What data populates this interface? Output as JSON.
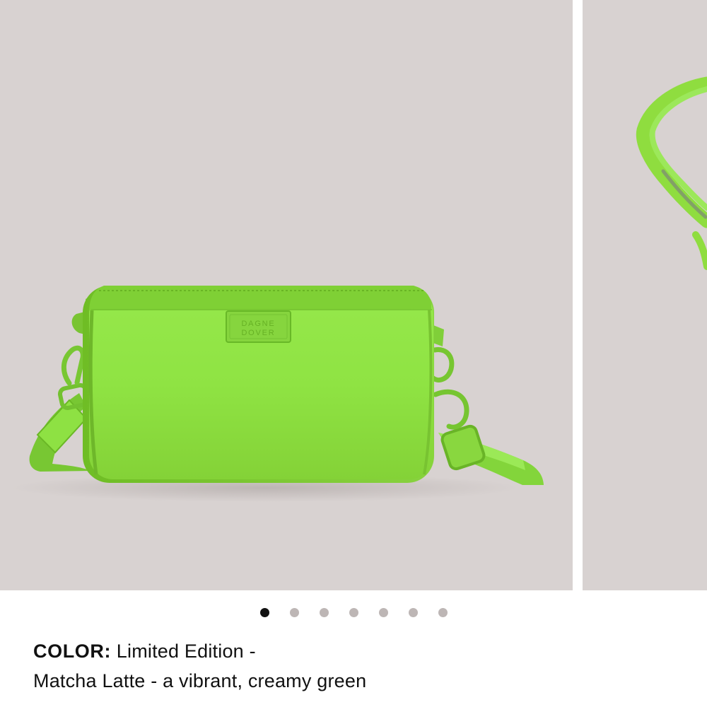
{
  "product": {
    "images": [
      {
        "name": "bag-front",
        "brand_logo_lines": [
          "DAGNE",
          "DOVER"
        ]
      },
      {
        "name": "bag-side"
      }
    ],
    "carousel": {
      "total_dots": 7,
      "active_dot": 1
    },
    "color": {
      "label": "COLOR:",
      "value_line1": "Limited Edition -",
      "value_line2": "Matcha Latte - a vibrant, creamy green"
    }
  },
  "colors": {
    "background": "#d8d2d1",
    "bag_green": "#8fdd3f",
    "active_dot": "#111111",
    "inactive_dot": "#bdb6b5"
  },
  "icons": {
    "pagination_dot": "circle"
  }
}
